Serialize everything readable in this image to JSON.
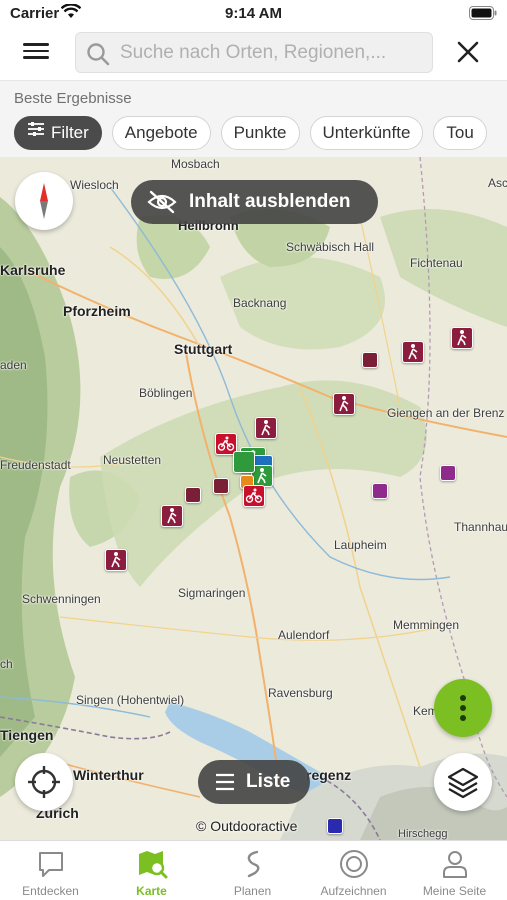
{
  "status_bar": {
    "carrier": "Carrier",
    "time": "9:14 AM"
  },
  "search": {
    "placeholder": "Suche nach Orten, Regionen,...",
    "value": ""
  },
  "results": {
    "label": "Beste Ergebnisse",
    "chips": [
      {
        "label": "Filter",
        "active": true
      },
      {
        "label": "Angebote",
        "active": false
      },
      {
        "label": "Punkte",
        "active": false
      },
      {
        "label": "Unterkünfte",
        "active": false
      },
      {
        "label": "Tou",
        "active": false
      }
    ]
  },
  "map": {
    "hide_content_label": "Inhalt ausblenden",
    "list_label": "Liste",
    "attribution": "© Outdooractive",
    "places": [
      "Mosbach",
      "Wiesloch",
      "Heilbronn",
      "Schwäbisch Hall",
      "Fichtenau",
      "Karlsruhe",
      "Pforzheim",
      "Backnang",
      "Stuttgart",
      "Giengen an der Brenz",
      "Böblingen",
      "Neustetten",
      "Freudenstadt",
      "Laupheim",
      "Thannhaus",
      "Schwenningen",
      "Sigmaringen",
      "Aulendorf",
      "Memmingen",
      "Singen (Hohentwiel)",
      "Ravensburg",
      "Kem",
      "Tiengen",
      "Winterthur",
      "regenz",
      "Zurich",
      "Hirschegg",
      "Asche",
      "aden",
      "ch"
    ]
  },
  "colors": {
    "accent": "#7bbf23",
    "marker": "#8b1e3f",
    "pill": "#464646"
  },
  "tabs": [
    {
      "label": "Entdecken",
      "icon": "chat-bubble-icon",
      "active": false
    },
    {
      "label": "Karte",
      "icon": "map-search-icon",
      "active": true
    },
    {
      "label": "Planen",
      "icon": "route-icon",
      "active": false
    },
    {
      "label": "Aufzeichnen",
      "icon": "record-icon",
      "active": false
    },
    {
      "label": "Meine Seite",
      "icon": "person-icon",
      "active": false
    }
  ]
}
